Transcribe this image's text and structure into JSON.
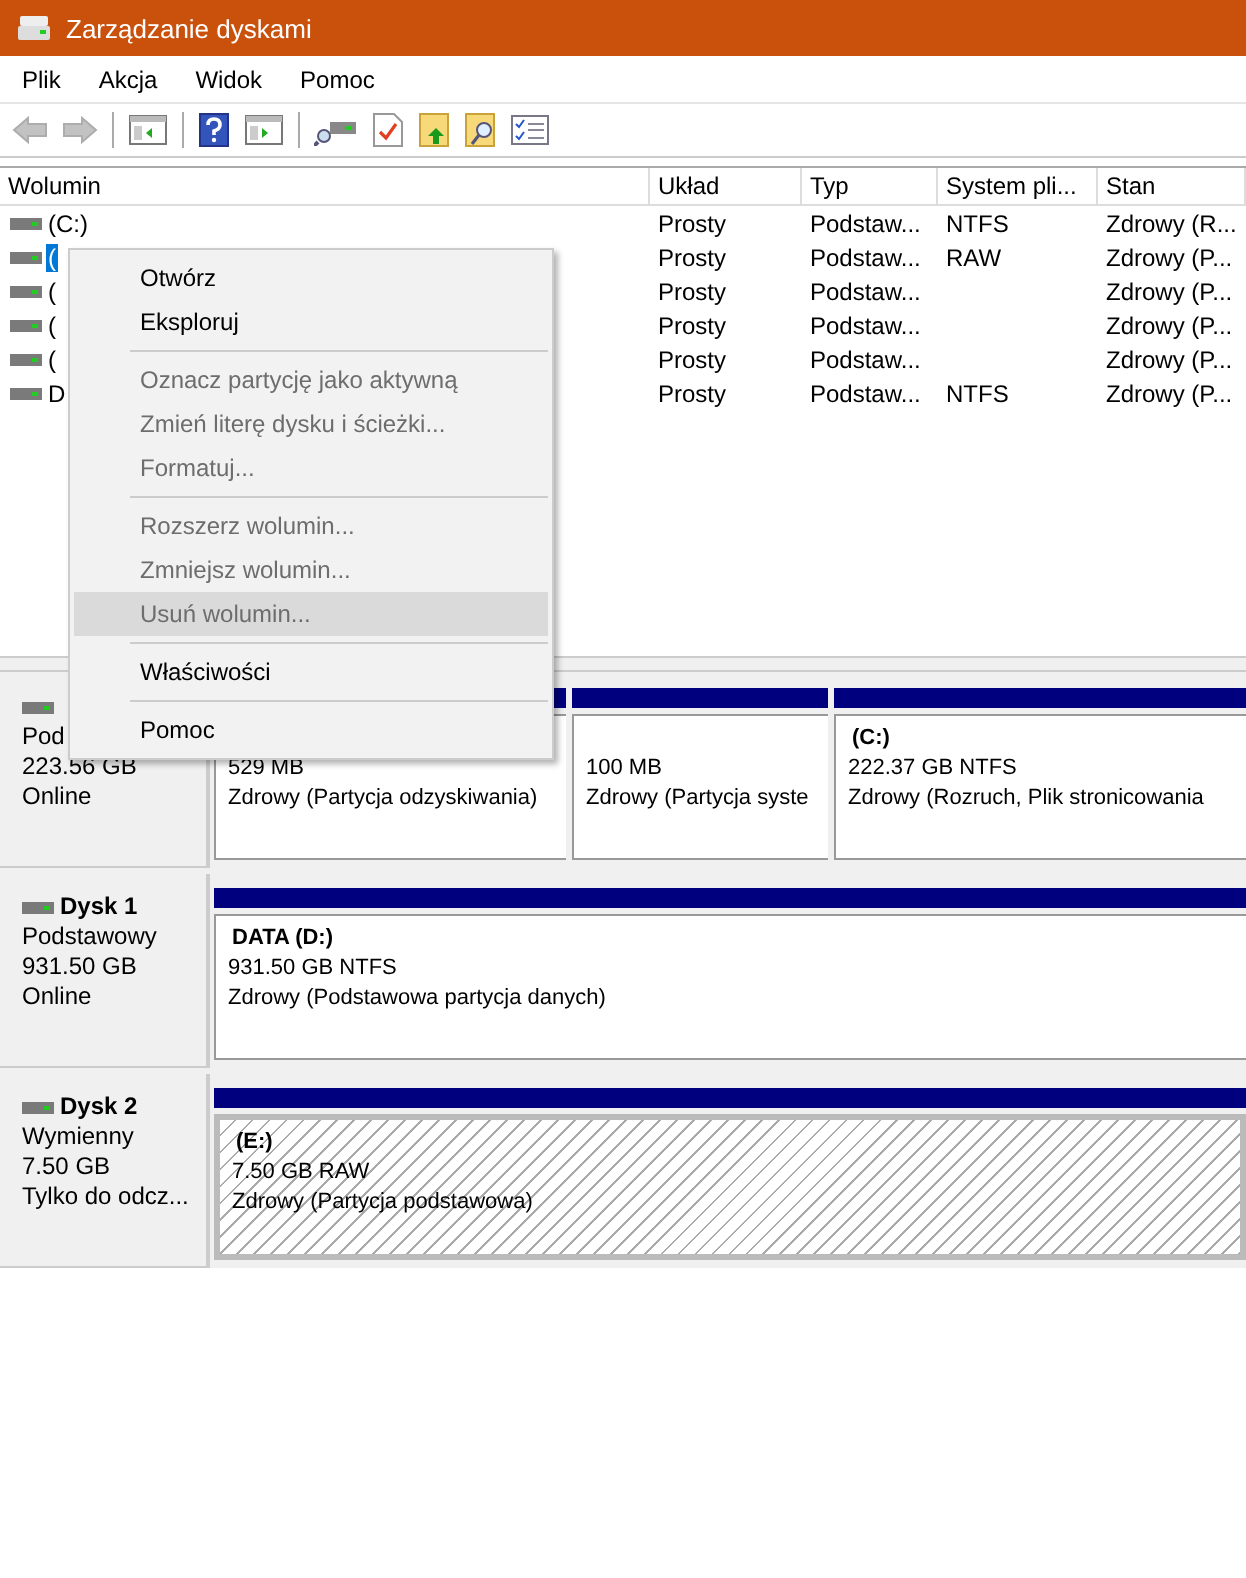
{
  "window": {
    "title": "Zarządzanie dyskami"
  },
  "menu_bar": [
    "Plik",
    "Akcja",
    "Widok",
    "Pomoc"
  ],
  "toolbar": [
    {
      "kind": "back",
      "disabled": true
    },
    {
      "kind": "forward",
      "disabled": true
    },
    {
      "kind": "sep"
    },
    {
      "kind": "panel-left"
    },
    {
      "kind": "sep"
    },
    {
      "kind": "help"
    },
    {
      "kind": "panel-right"
    },
    {
      "kind": "sep"
    },
    {
      "kind": "connect"
    },
    {
      "kind": "check-doc"
    },
    {
      "kind": "folder-up"
    },
    {
      "kind": "folder-search"
    },
    {
      "kind": "checklist"
    }
  ],
  "table": {
    "columns": [
      "Wolumin",
      "Układ",
      "Typ",
      "System pli...",
      "Stan"
    ],
    "rows": [
      {
        "volume": "(C:)",
        "layout": "Prosty",
        "type": "Podstaw...",
        "fs": "NTFS",
        "status": "Zdrowy (R...",
        "selected": false
      },
      {
        "volume": "(",
        "layout": "Prosty",
        "type": "Podstaw...",
        "fs": "RAW",
        "status": "Zdrowy (P...",
        "selected": true
      },
      {
        "volume": "(",
        "layout": "Prosty",
        "type": "Podstaw...",
        "fs": "",
        "status": "Zdrowy (P...",
        "selected": false
      },
      {
        "volume": "(",
        "layout": "Prosty",
        "type": "Podstaw...",
        "fs": "",
        "status": "Zdrowy (P...",
        "selected": false
      },
      {
        "volume": "(",
        "layout": "Prosty",
        "type": "Podstaw...",
        "fs": "",
        "status": "Zdrowy (P...",
        "selected": false
      },
      {
        "volume": "D",
        "layout": "Prosty",
        "type": "Podstaw...",
        "fs": "NTFS",
        "status": "Zdrowy (P...",
        "selected": false
      }
    ]
  },
  "disks": [
    {
      "type": "Pod",
      "size": "223.56 GB",
      "state": "Online",
      "partitions": [
        {
          "size": "529 MB",
          "status": "Zdrowy (Partycja odzyskiwania)",
          "selected": false
        },
        {
          "size": "100 MB",
          "status": "Zdrowy (Partycja syste",
          "selected": false
        },
        {
          "label": "(C:)",
          "size": "222.37 GB NTFS",
          "status": "Zdrowy (Rozruch, Plik stronicowania",
          "selected": false
        }
      ]
    },
    {
      "name": "Dysk 1",
      "type": "Podstawowy",
      "size": "931.50 GB",
      "state": "Online",
      "partitions": [
        {
          "label": "DATA  (D:)",
          "size": "931.50 GB NTFS",
          "status": "Zdrowy (Podstawowa partycja danych)",
          "selected": false
        }
      ]
    },
    {
      "name": "Dysk 2",
      "type": "Wymienny",
      "size": "7.50 GB",
      "state": "Tylko do odcz...",
      "partitions": [
        {
          "label": "(E:)",
          "size": "7.50 GB RAW",
          "status": "Zdrowy (Partycja podstawowa)",
          "selected": true
        }
      ]
    }
  ],
  "context_menu": [
    {
      "kind": "item",
      "label": "Otwórz",
      "disabled": false,
      "selected": false
    },
    {
      "kind": "item",
      "label": "Eksploruj",
      "disabled": false,
      "selected": false
    },
    {
      "kind": "sep"
    },
    {
      "kind": "item",
      "label": "Oznacz partycję jako aktywną",
      "disabled": true,
      "selected": false
    },
    {
      "kind": "item",
      "label": "Zmień literę dysku i ścieżki...",
      "disabled": true,
      "selected": false
    },
    {
      "kind": "item",
      "label": "Formatuj...",
      "disabled": true,
      "selected": false
    },
    {
      "kind": "sep"
    },
    {
      "kind": "item",
      "label": "Rozszerz wolumin...",
      "disabled": true,
      "selected": false
    },
    {
      "kind": "item",
      "label": "Zmniejsz wolumin...",
      "disabled": true,
      "selected": false
    },
    {
      "kind": "item",
      "label": "Usuń wolumin...",
      "disabled": true,
      "selected": true
    },
    {
      "kind": "sep"
    },
    {
      "kind": "item",
      "label": "Właściwości",
      "disabled": false,
      "selected": false
    },
    {
      "kind": "sep"
    },
    {
      "kind": "item",
      "label": "Pomoc",
      "disabled": false,
      "selected": false
    }
  ]
}
